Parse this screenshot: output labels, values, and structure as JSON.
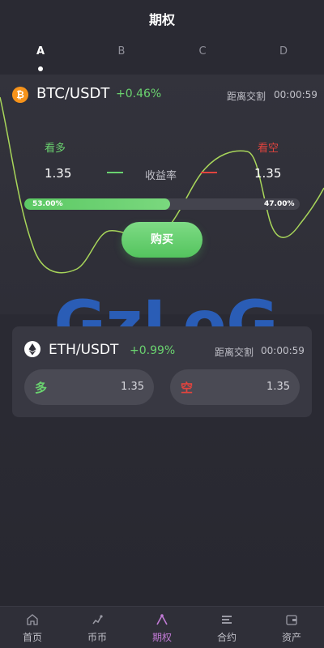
{
  "header": {
    "title": "期权"
  },
  "tabs": [
    {
      "label": "A",
      "active": true
    },
    {
      "label": "B",
      "active": false
    },
    {
      "label": "C",
      "active": false
    },
    {
      "label": "D",
      "active": false
    }
  ],
  "main_pair": {
    "icon": "bitcoin-icon",
    "symbol_glyph": "₿",
    "name": "BTC/USDT",
    "change": "+0.46%",
    "countdown_label": "距离交割",
    "countdown": "00:00:59",
    "long_label": "看多",
    "short_label": "看空",
    "long_odds": "1.35",
    "short_odds": "1.35",
    "yield_label": "收益率",
    "long_ratio_text": "53.00%",
    "short_ratio_text": "47.00%",
    "long_ratio": 0.53,
    "buy_label": "购买"
  },
  "watermark": {
    "text": "GzLoG"
  },
  "second_pair": {
    "icon": "ethereum-icon",
    "name": "ETH/USDT",
    "change": "+0.99%",
    "countdown_label": "距离交割",
    "countdown": "00:00:59",
    "long_label": "多",
    "long_odds": "1.35",
    "short_label": "空",
    "short_odds": "1.35"
  },
  "bottom_nav": [
    {
      "label": "首页",
      "icon": "home-icon",
      "active": false
    },
    {
      "label": "币币",
      "icon": "exchange-icon",
      "active": false
    },
    {
      "label": "期权",
      "icon": "options-icon",
      "active": true
    },
    {
      "label": "合约",
      "icon": "contract-icon",
      "active": false
    },
    {
      "label": "资产",
      "icon": "wallet-icon",
      "active": false
    }
  ],
  "colors": {
    "background": "#2a2a33",
    "up_green": "#6ad26f",
    "down_red": "#e0443e",
    "accent_purple": "#c27bd6",
    "watermark_blue": "#2a64c8"
  }
}
